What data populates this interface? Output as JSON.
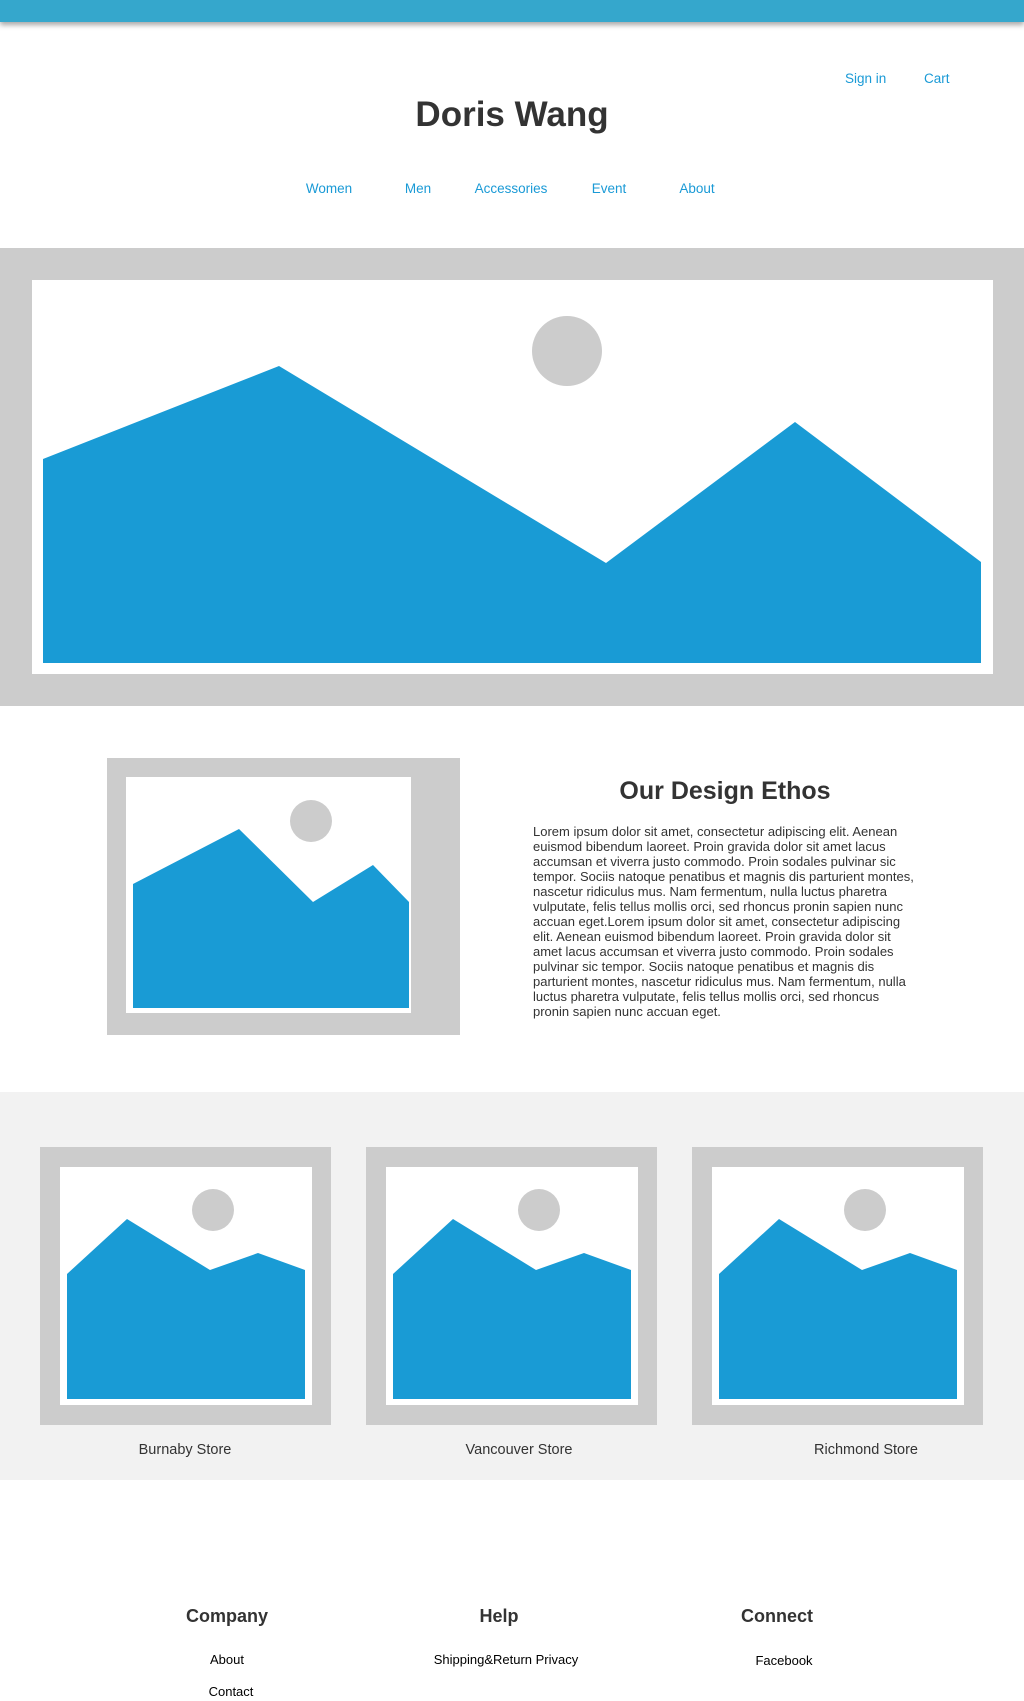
{
  "header": {
    "sign_in": "Sign in",
    "cart": "Cart",
    "brand": "Doris Wang"
  },
  "nav": {
    "items": [
      {
        "label": "Women"
      },
      {
        "label": "Men"
      },
      {
        "label": "Accessories"
      },
      {
        "label": "Event"
      },
      {
        "label": "About"
      }
    ]
  },
  "ethos": {
    "title": "Our Design Ethos",
    "body": "Lorem ipsum dolor sit amet, consectetur adipiscing elit. Aenean euismod bibendum laoreet. Proin gravida dolor sit amet lacus accumsan et viverra justo commodo. Proin sodales pulvinar sic tempor. Sociis natoque penatibus et magnis dis parturient montes, nascetur ridiculus mus. Nam fermentum, nulla luctus pharetra vulputate, felis tellus mollis orci, sed rhoncus pronin sapien nunc accuan eget.Lorem ipsum dolor sit amet, consectetur adipiscing elit. Aenean euismod bibendum laoreet. Proin gravida dolor sit amet lacus accumsan et viverra justo commodo. Proin sodales pulvinar sic tempor. Sociis natoque penatibus et magnis dis parturient montes, nascetur ridiculus mus. Nam fermentum, nulla luctus pharetra vulputate, felis tellus mollis orci, sed rhoncus pronin sapien nunc accuan eget."
  },
  "stores": [
    {
      "label": "Burnaby Store"
    },
    {
      "label": "Vancouver Store"
    },
    {
      "label": "Richmond Store"
    }
  ],
  "footer": {
    "company": {
      "heading": "Company",
      "links": [
        "About",
        "Contact"
      ]
    },
    "help": {
      "heading": "Help",
      "links": [
        "Shipping&Return Privacy"
      ]
    },
    "connect": {
      "heading": "Connect",
      "links": [
        "Facebook"
      ]
    }
  },
  "colors": {
    "accent": "#1a9ad6",
    "topbar": "#35a7cc",
    "placeholder_frame": "#cccccc",
    "mountain": "#199bd5",
    "stores_band": "#f2f2f2",
    "text": "#333333"
  },
  "icons": {
    "hero": "image-placeholder-icon",
    "ethos": "image-placeholder-icon",
    "stores": "image-placeholder-icon"
  }
}
